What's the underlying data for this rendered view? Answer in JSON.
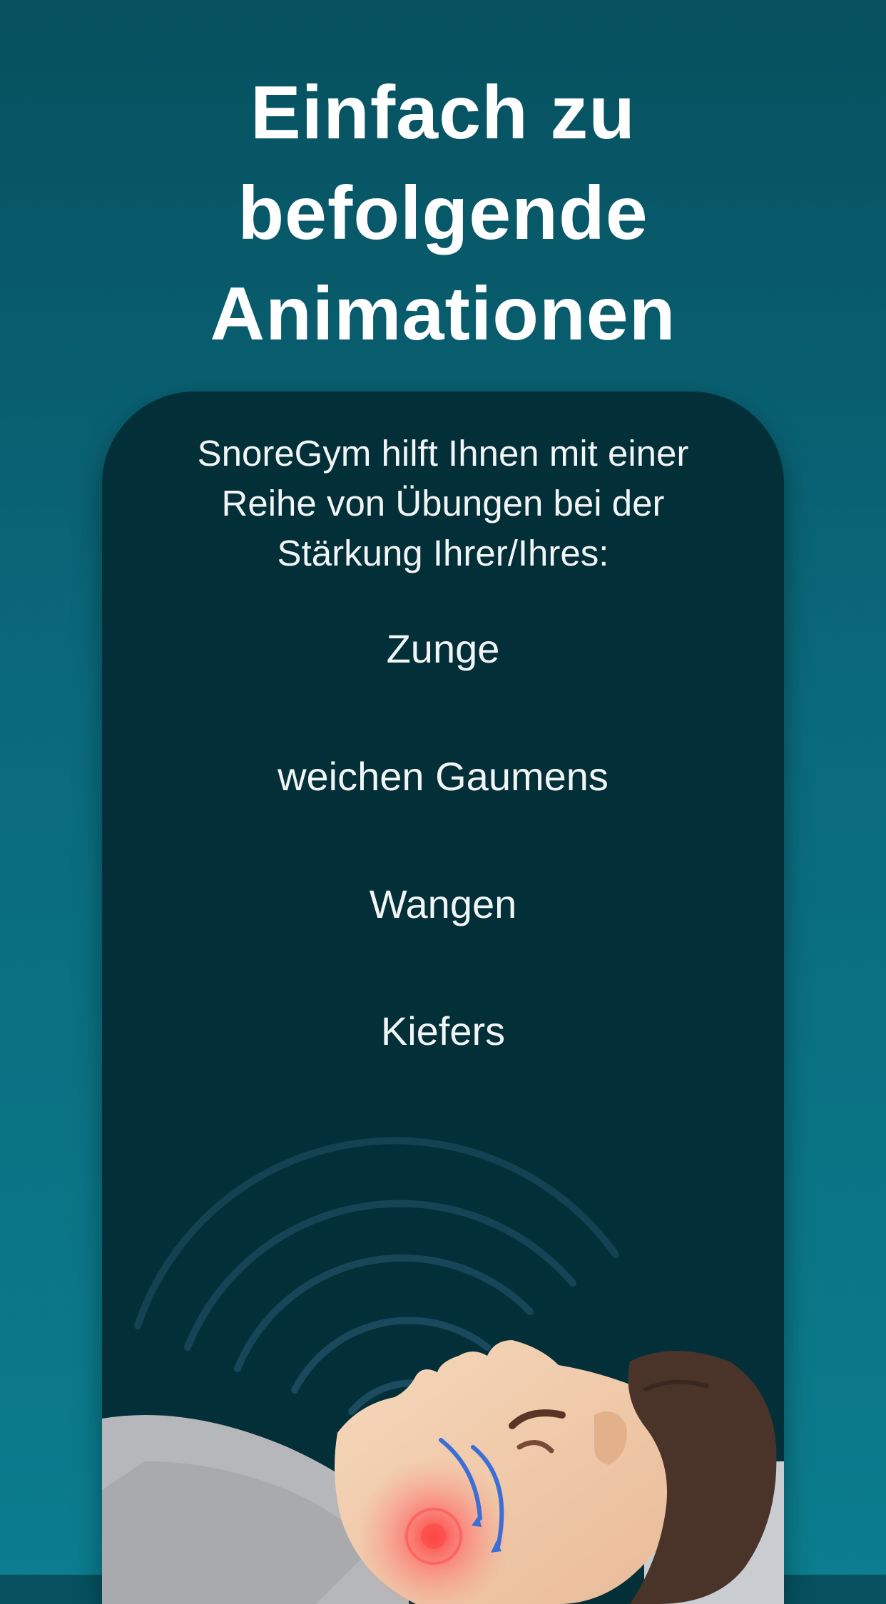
{
  "headline": {
    "line1": "Einfach zu",
    "line2": "befolgende",
    "line3": "Animationen"
  },
  "card": {
    "intro": {
      "line1": "SnoreGym hilft Ihnen mit einer",
      "line2": "Reihe von Übungen bei der",
      "line3": "Stärkung Ihrer/Ihres:"
    },
    "muscles": [
      "Zunge",
      "weichen Gaumens",
      "Wangen",
      "Kiefers"
    ]
  },
  "colors": {
    "background_top": "#06505f",
    "background_bottom": "#0b7d8e",
    "card": "#032f38",
    "text": "#ffffff"
  },
  "icons": {
    "illustration": "sleeping-person-throat-illustration"
  }
}
